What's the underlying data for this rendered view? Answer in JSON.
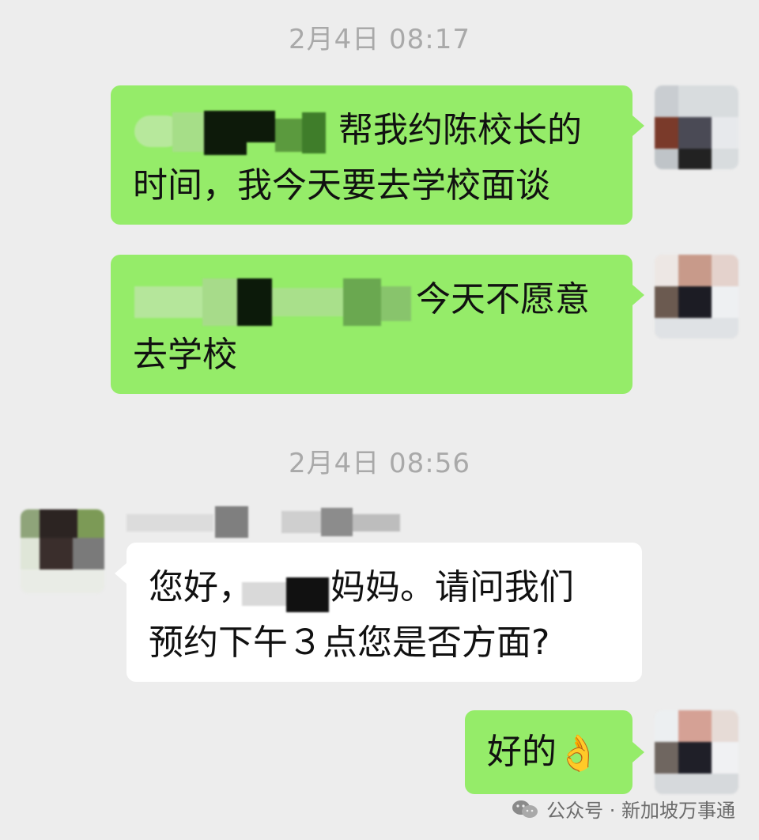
{
  "timestamps": [
    "2月4日 08:17",
    "2月4日 08:56"
  ],
  "messages": [
    {
      "side": "right",
      "lines": [
        "帮我约陈校长的",
        "时间，我今天要去学校面谈"
      ]
    },
    {
      "side": "right",
      "lines": [
        "今天不愿意",
        "去学校"
      ]
    },
    {
      "side": "left",
      "sender": "",
      "lines": [
        "您好，",
        "妈妈。请问我们",
        "预约下午３点您是否方面?"
      ]
    },
    {
      "side": "right",
      "lines": [
        "好的"
      ],
      "emoji": "👌"
    }
  ],
  "watermark": {
    "icon": "wechat-icon",
    "text": "公众号 · 新加坡万事通"
  },
  "colors": {
    "background": "#ededed",
    "sent_bubble": "#95ec69",
    "received_bubble": "#ffffff",
    "timestamp": "#a9a9a9"
  }
}
